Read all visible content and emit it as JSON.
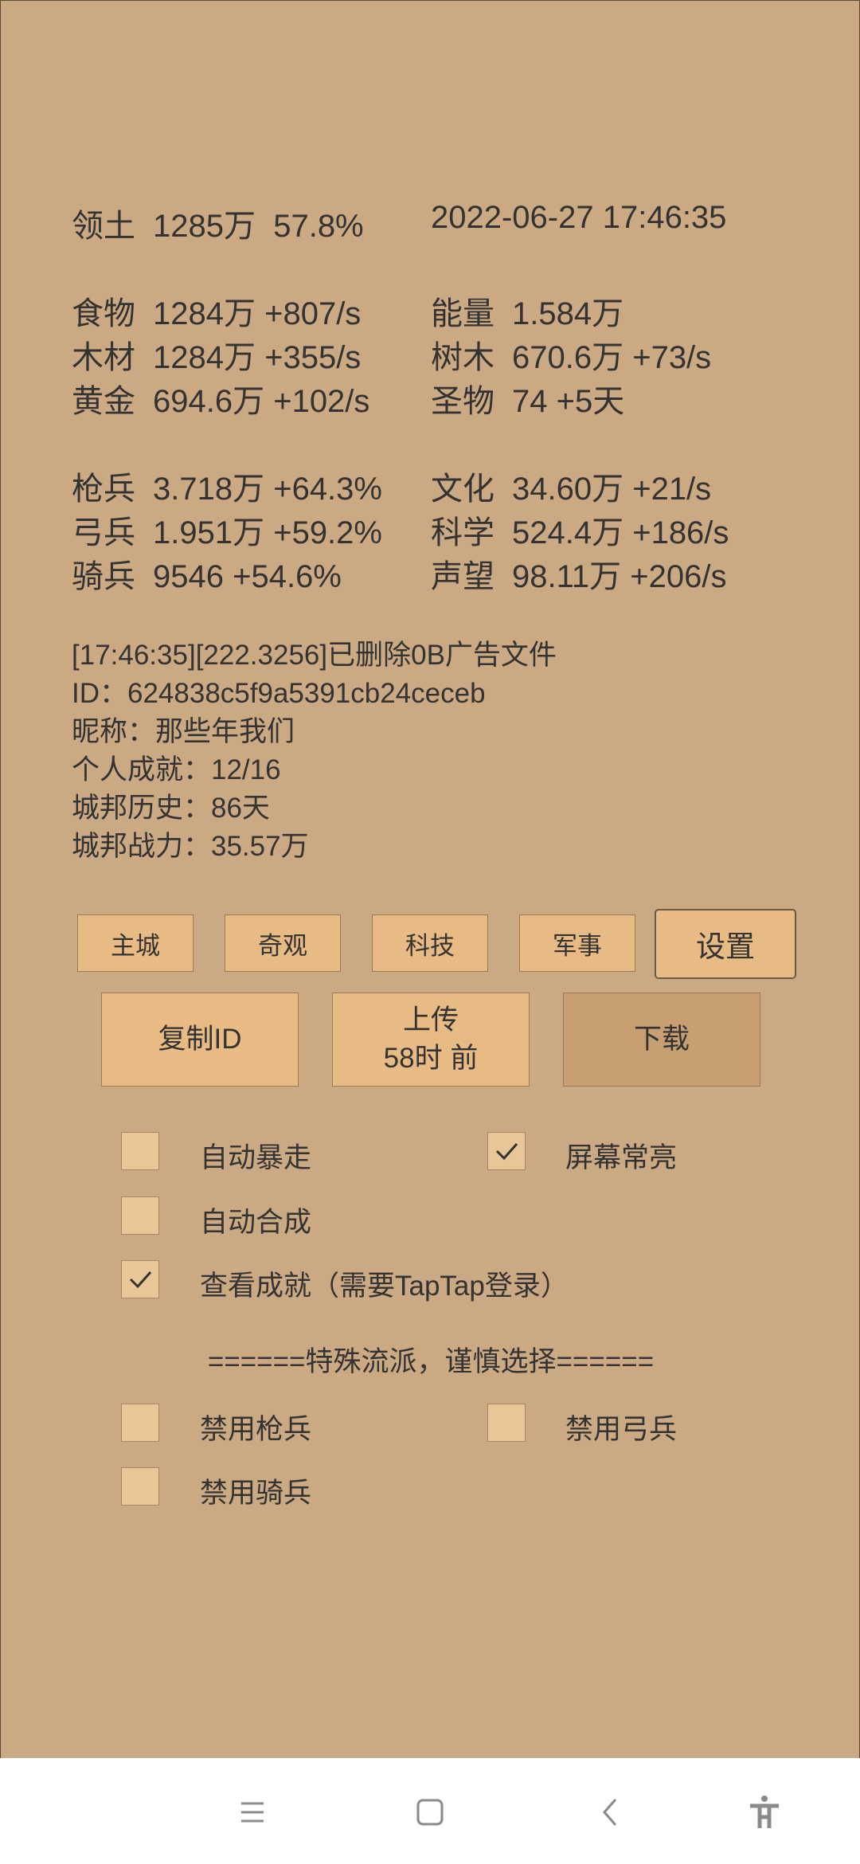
{
  "stats": {
    "territory": {
      "label": "领土",
      "value": "1285万  57.8%"
    },
    "datetime": "2022-06-27 17:46:35",
    "left": [
      {
        "label": "食物",
        "value": "1284万 +807/s"
      },
      {
        "label": "木材",
        "value": "1284万 +355/s"
      },
      {
        "label": "黄金",
        "value": "694.6万 +102/s"
      },
      {
        "label": "枪兵",
        "value": "3.718万 +64.3%"
      },
      {
        "label": "弓兵",
        "value": "1.951万 +59.2%"
      },
      {
        "label": "骑兵",
        "value": "9546 +54.6%"
      }
    ],
    "right": [
      {
        "label": "能量",
        "value": "1.584万"
      },
      {
        "label": "树木",
        "value": "670.6万 +73/s"
      },
      {
        "label": "圣物",
        "value": "74 +5天"
      },
      {
        "label": "文化",
        "value": "34.60万 +21/s"
      },
      {
        "label": "科学",
        "value": "524.4万 +186/s"
      },
      {
        "label": "声望",
        "value": "98.11万 +206/s"
      }
    ]
  },
  "info": {
    "log": "[17:46:35][222.3256]已删除0B广告文件",
    "id": "ID：624838c5f9a5391cb24ceceb",
    "nickname": "昵称：那些年我们",
    "achievements": "个人成就：12/16",
    "history": "城邦历史：86天",
    "power": "城邦战力：35.57万"
  },
  "nav_tabs": [
    {
      "label": "主城",
      "selected": false
    },
    {
      "label": "奇观",
      "selected": false
    },
    {
      "label": "科技",
      "selected": false
    },
    {
      "label": "军事",
      "selected": false
    },
    {
      "label": "设置",
      "selected": true
    }
  ],
  "actions": {
    "copy_id": "复制ID",
    "upload_line1": "上传",
    "upload_line2": "58时 前",
    "download": "下载"
  },
  "options": {
    "auto_rampage": {
      "label": "自动暴走",
      "checked": false
    },
    "screen_on": {
      "label": "屏幕常亮",
      "checked": true
    },
    "auto_merge": {
      "label": "自动合成",
      "checked": false
    },
    "view_achievements": {
      "label": "查看成就（需要TapTap登录）",
      "checked": true
    },
    "divider": "======特殊流派，谨慎选择======",
    "disable_spear": {
      "label": "禁用枪兵",
      "checked": false
    },
    "disable_archer": {
      "label": "禁用弓兵",
      "checked": false
    },
    "disable_cavalry": {
      "label": "禁用骑兵",
      "checked": false
    }
  },
  "system_nav": {
    "icons": [
      "menu-icon",
      "home-icon",
      "back-icon",
      "accessibility-icon"
    ]
  },
  "colors": {
    "background": "#cbaa83",
    "button": "#e8ba84",
    "button_pressed": "#c79f72",
    "checkbox": "#e8c698",
    "text": "#333333"
  }
}
